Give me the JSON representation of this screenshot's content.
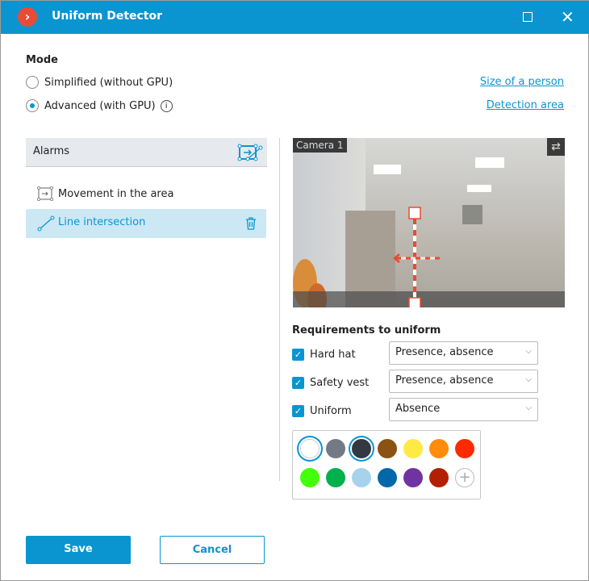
{
  "window": {
    "title": "Uniform Detector",
    "logo_glyph": "›"
  },
  "mode": {
    "heading": "Mode",
    "options": [
      {
        "label": "Simplified (without GPU)",
        "selected": false
      },
      {
        "label": "Advanced (with GPU)",
        "selected": true
      }
    ],
    "links": {
      "size": "Size of a person",
      "area": "Detection area"
    }
  },
  "alarms": {
    "heading": "Alarms",
    "items": [
      {
        "label": "Movement in the area",
        "icon": "area-icon",
        "selected": false
      },
      {
        "label": "Line intersection",
        "icon": "line-icon",
        "selected": true
      }
    ]
  },
  "camera": {
    "label": "Camera 1"
  },
  "requirements": {
    "heading": "Requirements to uniform",
    "rows": [
      {
        "label": "Hard hat",
        "checked": true,
        "value": "Presence, absence"
      },
      {
        "label": "Safety vest",
        "checked": true,
        "value": "Presence, absence"
      },
      {
        "label": "Uniform",
        "checked": true,
        "value": "Absence"
      }
    ]
  },
  "palette": {
    "colors": [
      "#ffffff",
      "#737985",
      "#343842",
      "#8a5213",
      "#ffea45",
      "#ff8c0a",
      "#ff2a00",
      "#44ff0a",
      "#00b04c",
      "#a6d2ec",
      "#0068a8",
      "#7133a1",
      "#b31f02"
    ],
    "selected": [
      "#ffffff",
      "#343842"
    ]
  },
  "accent": "#0a95d1",
  "buttons": {
    "save": "Save",
    "cancel": "Cancel"
  }
}
